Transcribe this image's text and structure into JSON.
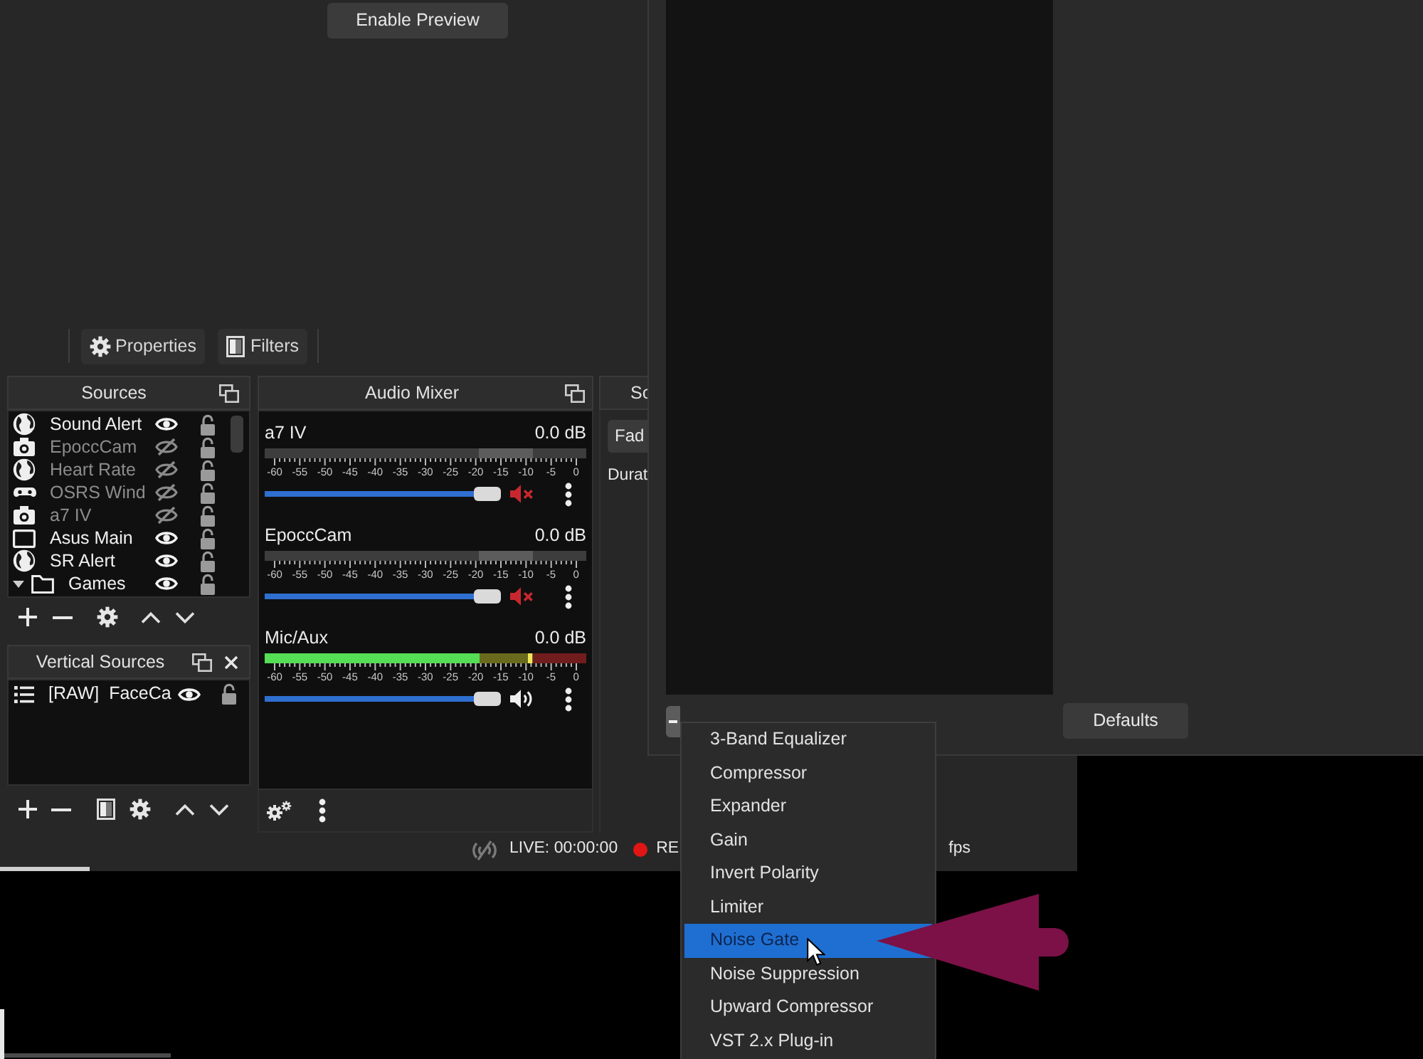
{
  "preview": {
    "button": "Enable Preview"
  },
  "toolbar": {
    "properties": "Properties",
    "filters": "Filters"
  },
  "sources": {
    "title": "Sources",
    "items": [
      {
        "kind": "globe",
        "name": "Sound Alert",
        "visible": true
      },
      {
        "kind": "camera",
        "name": "EpoccCam",
        "visible": false
      },
      {
        "kind": "globe",
        "name": "Heart Rate",
        "visible": false
      },
      {
        "kind": "gamepad",
        "name": "OSRS Wind",
        "visible": false
      },
      {
        "kind": "camera",
        "name": "a7 IV",
        "visible": false
      },
      {
        "kind": "monitor",
        "name": "Asus Main",
        "visible": true
      },
      {
        "kind": "globe",
        "name": "SR Alert",
        "visible": true
      },
      {
        "kind": "group",
        "name": "Games",
        "visible": true,
        "expanded": true
      }
    ]
  },
  "vertical_sources": {
    "title": "Vertical Sources",
    "items": [
      {
        "kind": "scene",
        "name": "[RAW]  FaceCa",
        "visible": true
      }
    ]
  },
  "audio_mixer": {
    "title": "Audio Mixer",
    "channels": [
      {
        "name": "a7 IV",
        "reading": "0.0 dB",
        "muted": true,
        "scale": [
          "-60",
          "-55",
          "-50",
          "-45",
          "-40",
          "-35",
          "-30",
          "-25",
          "-20",
          "-15",
          "-10",
          "-5",
          "0"
        ],
        "volume": {
          "level": 1
        }
      },
      {
        "name": "EpoccCam",
        "reading": "0.0 dB",
        "muted": true,
        "scale": [
          "-60",
          "-55",
          "-50",
          "-45",
          "-40",
          "-35",
          "-30",
          "-25",
          "-20",
          "-15",
          "-10",
          "-5",
          "0"
        ],
        "volume": {
          "level": 1
        }
      },
      {
        "name": "Mic/Aux",
        "reading": "0.0 dB",
        "muted": false,
        "meter": {
          "level": 0.67
        },
        "peak": {
          "level": 0.82
        },
        "scale": [
          "-60",
          "-55",
          "-50",
          "-45",
          "-40",
          "-35",
          "-30",
          "-25",
          "-20",
          "-15",
          "-10",
          "-5",
          "0"
        ],
        "volume": {
          "level": 1
        }
      }
    ]
  },
  "scene_transitions": {
    "title": "Sc",
    "dropdown": "Fad",
    "label": "Durat"
  },
  "status_bar": {
    "live": "LIVE: 00:00:00",
    "recording": "RE",
    "fps": "fps"
  },
  "filters_dialog": {
    "defaults_button": "Defaults"
  },
  "context_menu": {
    "items": [
      {
        "label": "3-Band Equalizer",
        "selected": false
      },
      {
        "label": "Compressor",
        "selected": false
      },
      {
        "label": "Expander",
        "selected": false
      },
      {
        "label": "Gain",
        "selected": false
      },
      {
        "label": "Invert Polarity",
        "selected": false
      },
      {
        "label": "Limiter",
        "selected": false
      },
      {
        "label": "Noise Gate",
        "selected": true
      },
      {
        "label": "Noise Suppression",
        "selected": false
      },
      {
        "label": "Upward Compressor",
        "selected": false
      },
      {
        "label": "VST 2.x Plug-in",
        "selected": false
      }
    ]
  }
}
